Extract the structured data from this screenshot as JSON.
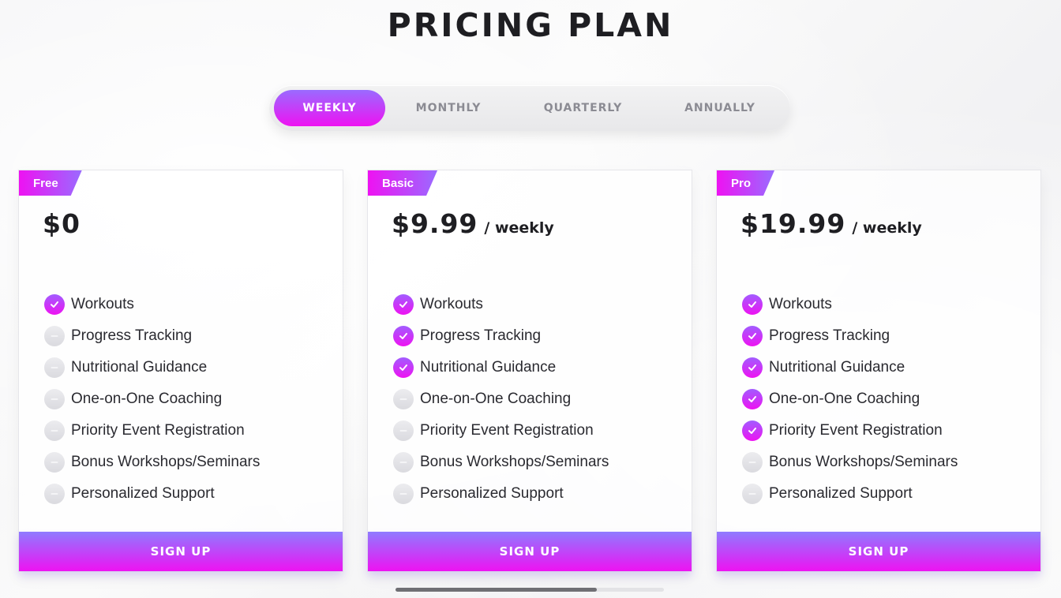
{
  "title": "PRICING PLAN",
  "billing_options": [
    {
      "label": "WEEKLY",
      "active": true
    },
    {
      "label": "MONTHLY",
      "active": false
    },
    {
      "label": "QUARTERLY",
      "active": false
    },
    {
      "label": "ANNUALLY",
      "active": false
    }
  ],
  "colors": {
    "accent_start": "#9a6bff",
    "accent_end": "#ee12f2",
    "excluded_icon": "#dadadf",
    "text": "#1e1e22"
  },
  "icons": {
    "included": "check-circle-icon",
    "excluded": "minus-circle-icon"
  },
  "plans": [
    {
      "tag": "Free",
      "price": "$0",
      "period": "",
      "button": "SIGN UP",
      "features": [
        {
          "label": "Workouts",
          "included": true
        },
        {
          "label": "Progress Tracking",
          "included": false
        },
        {
          "label": "Nutritional Guidance",
          "included": false
        },
        {
          "label": "One-on-One Coaching",
          "included": false
        },
        {
          "label": "Priority Event Registration",
          "included": false
        },
        {
          "label": "Bonus Workshops/Seminars",
          "included": false
        },
        {
          "label": "Personalized Support",
          "included": false
        }
      ]
    },
    {
      "tag": "Basic",
      "price": "$9.99",
      "period": "/ weekly",
      "button": "SIGN UP",
      "features": [
        {
          "label": "Workouts",
          "included": true
        },
        {
          "label": "Progress Tracking",
          "included": true
        },
        {
          "label": "Nutritional Guidance",
          "included": true
        },
        {
          "label": "One-on-One Coaching",
          "included": false
        },
        {
          "label": "Priority Event Registration",
          "included": false
        },
        {
          "label": "Bonus Workshops/Seminars",
          "included": false
        },
        {
          "label": "Personalized Support",
          "included": false
        }
      ]
    },
    {
      "tag": "Pro",
      "price": "$19.99",
      "period": "/ weekly",
      "button": "SIGN UP",
      "features": [
        {
          "label": "Workouts",
          "included": true
        },
        {
          "label": "Progress Tracking",
          "included": true
        },
        {
          "label": "Nutritional Guidance",
          "included": true
        },
        {
          "label": "One-on-One Coaching",
          "included": true
        },
        {
          "label": "Priority Event Registration",
          "included": true
        },
        {
          "label": "Bonus Workshops/Seminars",
          "included": false
        },
        {
          "label": "Personalized Support",
          "included": false
        }
      ]
    }
  ],
  "carousel_scroll_fraction": 0.75
}
